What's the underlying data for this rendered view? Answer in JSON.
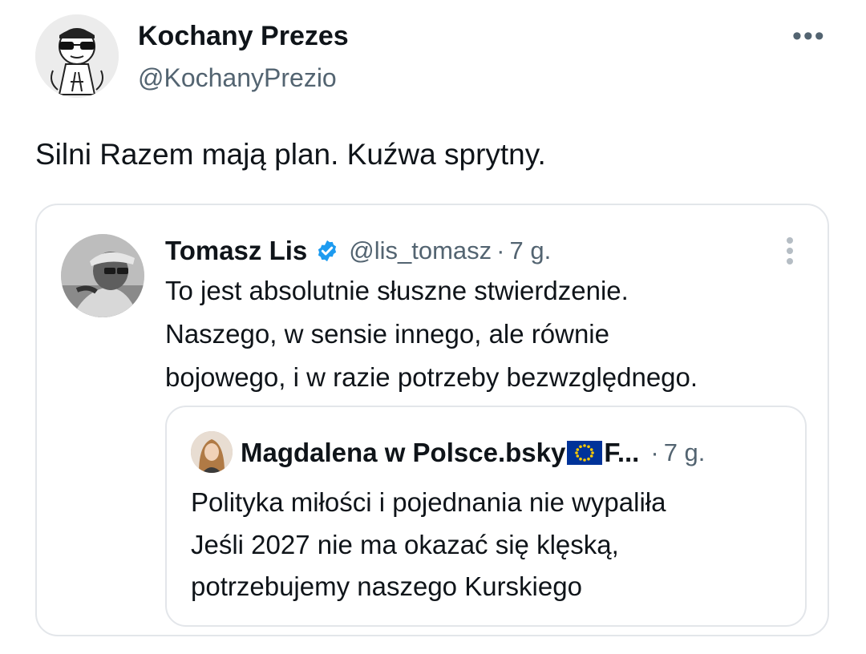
{
  "tweet": {
    "author": {
      "display_name": "Kochany Prezes",
      "handle": "@KochanyPrezio",
      "avatar_icon": "cartoon-avatar-with-sunglasses"
    },
    "more_icon": "ellipsis-horizontal-icon",
    "more_label": "•••",
    "text": "Silni Razem mają plan. Kuźwa sprytny."
  },
  "quote": {
    "author": {
      "display_name": "Tomasz Lis",
      "handle": "@lis_tomasz",
      "verified": true,
      "avatar_icon": "grayscale-photo-avatar"
    },
    "separator": "·",
    "time": "7 g.",
    "menu_icon": "ellipsis-vertical-icon",
    "lines": [
      "To jest absolutnie słuszne stwierdzenie.",
      "Naszego, w sensie innego, ale równie",
      "bojowego, i w razie potrzeby bezwzględnego."
    ],
    "nested_quote": {
      "author": {
        "display_name": "Magdalena w Polsce.bsky",
        "display_name_tail": "F...",
        "flag_icon": "eu-flag-icon",
        "avatar_icon": "photo-avatar"
      },
      "separator": "·",
      "time": "7 g.",
      "lines": [
        "Polityka miłości i pojednania nie wypaliła",
        "Jeśli 2027 nie ma okazać się klęską,",
        "potrzebujemy naszego Kurskiego"
      ]
    }
  },
  "colors": {
    "text_primary": "#0f1419",
    "text_secondary": "#536471",
    "border": "#e3e6ea",
    "verified_blue": "#1d9bf0",
    "eu_blue": "#003399",
    "eu_gold": "#ffcc00"
  }
}
